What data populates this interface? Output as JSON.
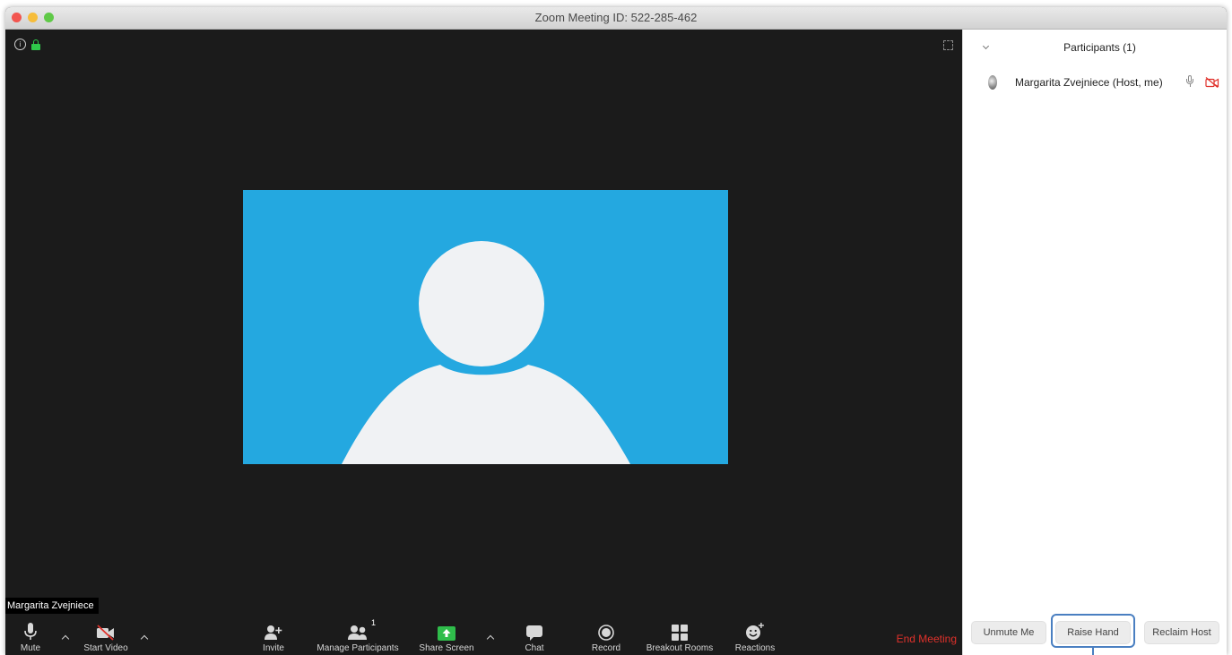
{
  "window": {
    "title": "Zoom Meeting ID: 522-285-462"
  },
  "video": {
    "participant_name_tag": "Margarita Zvejniece"
  },
  "toolbar": {
    "mute_label": "Mute",
    "start_video_label": "Start Video",
    "invite_label": "Invite",
    "manage_participants_label": "Manage Participants",
    "participant_count": "1",
    "share_screen_label": "Share Screen",
    "chat_label": "Chat",
    "record_label": "Record",
    "breakout_rooms_label": "Breakout Rooms",
    "reactions_label": "Reactions",
    "end_meeting_label": "End Meeting"
  },
  "participants_panel": {
    "title": "Participants (1)",
    "participants": [
      {
        "name": "Margarita Zvejniece (Host, me)"
      }
    ],
    "buttons": {
      "unmute_me": "Unmute Me",
      "raise_hand": "Raise Hand",
      "reclaim_host": "Reclaim Host"
    }
  },
  "colors": {
    "avatar_background": "#24a8e0",
    "end_meeting": "#e0312b",
    "share_screen": "#2fbd4b",
    "highlight_outline": "#4a7fc1"
  },
  "icons": [
    "info-icon",
    "lock-icon",
    "fullscreen-icon",
    "microphone-icon",
    "video-off-icon",
    "invite-icon",
    "participants-icon",
    "share-screen-icon",
    "chat-icon",
    "record-icon",
    "breakout-rooms-icon",
    "reactions-icon",
    "camera-off-icon"
  ]
}
